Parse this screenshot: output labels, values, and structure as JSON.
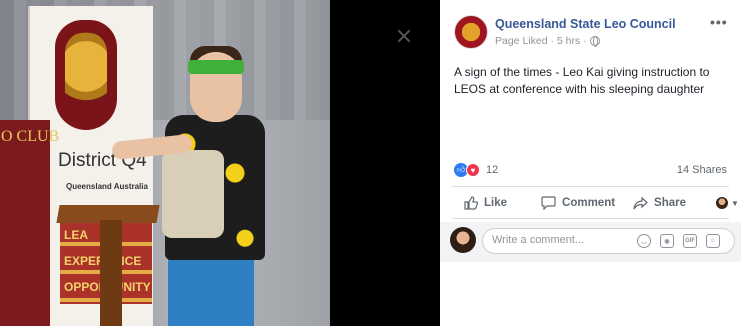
{
  "photo": {
    "banner_text": "District Q4",
    "banner_subtext": "Queensland Australia",
    "side_banner_text": "O CLUB",
    "lectern_lines": [
      "LEA",
      "EXPERIENCE",
      "OPPORTUNITY"
    ]
  },
  "post": {
    "page_name": "Queensland State Leo Council",
    "meta": "Page Liked · 5 hrs ·",
    "more": "•••",
    "text": "A sign of the times - Leo Kai giving instruction to LEOS at conference with his sleeping daughter",
    "reaction_count": "12",
    "shares": "14 Shares"
  },
  "actions": {
    "like": "Like",
    "comment": "Comment",
    "share": "Share"
  },
  "comment": {
    "placeholder": "Write a comment..."
  },
  "icons": {
    "emoji": "smiley-icon",
    "camera": "camera-icon",
    "gif": "GIF",
    "sticker": "sticker-icon"
  },
  "colors": {
    "link": "#385898",
    "like_reaction": "#2e7bf0",
    "love_reaction": "#f0364f"
  }
}
